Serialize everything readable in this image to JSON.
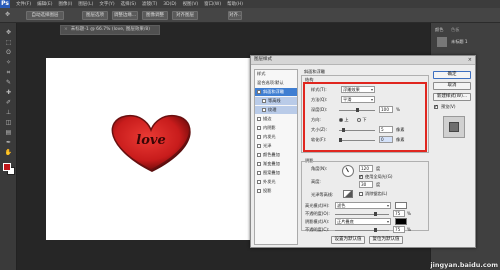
{
  "app": {
    "logo": "Ps",
    "menus": [
      "文件(F)",
      "编辑(E)",
      "图像(I)",
      "图层(L)",
      "文字(Y)",
      "选择(S)",
      "滤镜(T)",
      "3D(D)",
      "视图(V)",
      "窗口(W)",
      "帮助(H)"
    ]
  },
  "options_bar": {
    "buttons": [
      "自动选择图层",
      "图层选项",
      "调整边缘...",
      "图像调整",
      "对齐图层",
      "对齐..."
    ]
  },
  "document": {
    "tab_title": "未标题-1 @ 66.7% (love, 图层效果/8)",
    "close": "×"
  },
  "canvas_art": {
    "text": "love",
    "colors": {
      "heart": "#d42020",
      "outline": "#6a1010"
    }
  },
  "right_panel": {
    "color_label": "颜色",
    "swatch_label": "色板",
    "layer_name": "未标题 1"
  },
  "dialog": {
    "title": "图层样式",
    "close": "×",
    "style_list": [
      {
        "label": "样式",
        "checked": null,
        "state": "header"
      },
      {
        "label": "混合选项:默认",
        "checked": null,
        "state": "normal"
      },
      {
        "label": "斜面和浮雕",
        "checked": true,
        "state": "selected"
      },
      {
        "label": "等高线",
        "checked": false,
        "state": "sub"
      },
      {
        "label": "纹理",
        "checked": false,
        "state": "sub"
      },
      {
        "label": "描边",
        "checked": false,
        "state": "normal"
      },
      {
        "label": "内阴影",
        "checked": false,
        "state": "normal"
      },
      {
        "label": "内发光",
        "checked": false,
        "state": "normal"
      },
      {
        "label": "光泽",
        "checked": false,
        "state": "normal"
      },
      {
        "label": "颜色叠加",
        "checked": false,
        "state": "normal"
      },
      {
        "label": "渐变叠加",
        "checked": false,
        "state": "normal"
      },
      {
        "label": "图案叠加",
        "checked": false,
        "state": "normal"
      },
      {
        "label": "外发光",
        "checked": false,
        "state": "normal"
      },
      {
        "label": "投影",
        "checked": false,
        "state": "normal"
      }
    ],
    "structure": {
      "group_title": "斜面和浮雕",
      "sub_title": "结构",
      "style_label": "样式(T):",
      "style_value": "浮雕效果",
      "method_label": "方法(Q):",
      "method_value": "平滑",
      "depth_label": "深度(D):",
      "depth_value": "100",
      "depth_unit": "%",
      "direction_label": "方向:",
      "dir_up": "上",
      "dir_down": "下",
      "size_label": "大小(Z):",
      "size_value": "5",
      "size_unit": "像素",
      "soften_label": "软化(F):",
      "soften_value": "0",
      "soften_unit": "像素",
      "depth_level": 0.5,
      "size_level": 0.1,
      "soften_level": 0.0
    },
    "shading": {
      "title": "阴影",
      "angle_label": "角度(N):",
      "angle_value": "120",
      "angle_unit": "度",
      "global_light_label": "使用全局光(G)",
      "altitude_label": "高度:",
      "altitude_value": "30",
      "altitude_unit": "度",
      "gloss_label": "光泽等高线:",
      "antialias_label": "消除锯齿(L)",
      "highlight_label": "高光模式(H):",
      "highlight_value": "滤色",
      "opacity1_label": "不透明度(O):",
      "opacity1_value": "75",
      "opacity1_unit": "%",
      "shadow_label": "阴影模式(A):",
      "shadow_value": "正片叠底",
      "opacity2_label": "不透明度(C):",
      "opacity2_value": "75",
      "opacity2_unit": "%"
    },
    "footer": {
      "default_btn": "设置为默认值",
      "reset_btn": "复位为默认值"
    },
    "buttons": {
      "ok": "确定",
      "cancel": "取消",
      "new_style": "新建样式(W)...",
      "preview": "预览(V)"
    },
    "colors": {
      "highlight_box": "#e0261f",
      "selected": "#3f7ed2"
    }
  },
  "watermark": "jingyan.baidu.com"
}
